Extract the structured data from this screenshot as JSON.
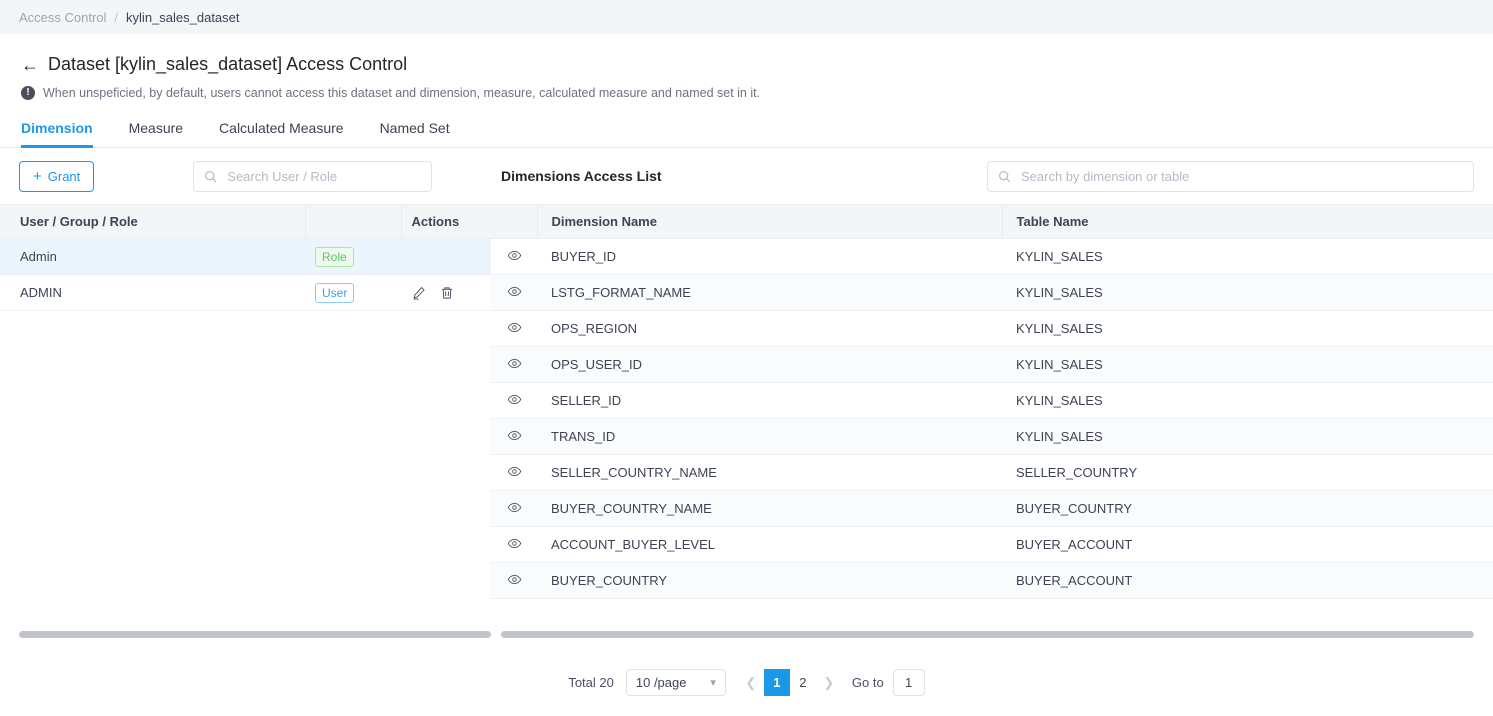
{
  "breadcrumb": {
    "parent": "Access Control",
    "separator": "/",
    "current": "kylin_sales_dataset"
  },
  "header": {
    "back_icon": "arrow-left-icon",
    "title": "Dataset [kylin_sales_dataset] Access Control",
    "info_icon": "info-icon",
    "info_text": "When unspeficied, by default, users cannot access this dataset and dimension, measure, calculated measure and named set in it."
  },
  "tabs": [
    {
      "label": "Dimension",
      "active": true
    },
    {
      "label": "Measure",
      "active": false
    },
    {
      "label": "Calculated Measure",
      "active": false
    },
    {
      "label": "Named Set",
      "active": false
    }
  ],
  "left_panel": {
    "grant_button": "Grant",
    "grant_icon": "plus-icon",
    "search_placeholder": "Search User / Role",
    "search_value": "",
    "search_icon": "search-icon",
    "columns": [
      "User / Group / Role",
      "",
      "Actions"
    ],
    "rows": [
      {
        "name": "Admin",
        "badge": "Role",
        "badge_type": "role",
        "actions": false,
        "highlight": true
      },
      {
        "name": "ADMIN",
        "badge": "User",
        "badge_type": "user",
        "actions": true,
        "highlight": false
      }
    ],
    "action_icons": [
      "edit-icon",
      "delete-icon"
    ]
  },
  "right_panel": {
    "title": "Dimensions Access List",
    "search_placeholder": "Search by dimension or table",
    "search_value": "",
    "search_icon": "search-icon",
    "columns": [
      "",
      "Dimension Name",
      "Table Name"
    ],
    "row_icon": "eye-icon",
    "rows": [
      {
        "dimension": "BUYER_ID",
        "table": "KYLIN_SALES"
      },
      {
        "dimension": "LSTG_FORMAT_NAME",
        "table": "KYLIN_SALES"
      },
      {
        "dimension": "OPS_REGION",
        "table": "KYLIN_SALES"
      },
      {
        "dimension": "OPS_USER_ID",
        "table": "KYLIN_SALES"
      },
      {
        "dimension": "SELLER_ID",
        "table": "KYLIN_SALES"
      },
      {
        "dimension": "TRANS_ID",
        "table": "KYLIN_SALES"
      },
      {
        "dimension": "SELLER_COUNTRY_NAME",
        "table": "SELLER_COUNTRY"
      },
      {
        "dimension": "BUYER_COUNTRY_NAME",
        "table": "BUYER_COUNTRY"
      },
      {
        "dimension": "ACCOUNT_BUYER_LEVEL",
        "table": "BUYER_ACCOUNT"
      },
      {
        "dimension": "BUYER_COUNTRY",
        "table": "BUYER_ACCOUNT"
      }
    ]
  },
  "pagination": {
    "total_label": "Total 20",
    "page_size": "10 /page",
    "prev_icon": "chevron-left-icon",
    "next_icon": "chevron-right-icon",
    "pages": [
      "1",
      "2"
    ],
    "current_page": "1",
    "goto_label": "Go to",
    "goto_value": "1"
  },
  "colors": {
    "accent": "#1b98e8",
    "role_badge": "#5ec75e",
    "user_badge": "#3ba1ef",
    "header_bg": "#f4f5f7",
    "row_alt_bg": "#fafbfc",
    "row_highlight_bg": "#ecf5fd"
  }
}
